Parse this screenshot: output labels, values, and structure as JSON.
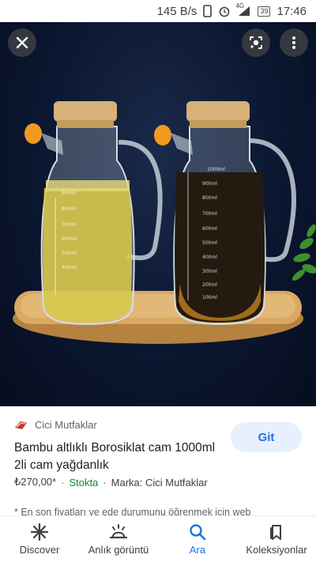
{
  "status_bar": {
    "speed": "145 B/s",
    "network": "4G",
    "battery": "39",
    "time": "17:46"
  },
  "viewer": {
    "close_icon": "close-icon",
    "lens_icon": "google-lens-icon",
    "menu_icon": "more-vert-icon",
    "bottle_markings_left": [
      "900ml",
      "800ml",
      "700ml",
      "600ml",
      "500ml",
      "400ml"
    ],
    "bottle_markings_right": [
      "1000ml",
      "900ml",
      "800ml",
      "700ml",
      "600ml",
      "500ml",
      "400ml",
      "300ml",
      "200ml",
      "100ml"
    ]
  },
  "result": {
    "source": "Cici Mutfaklar",
    "visit_button": "Git",
    "title": "Bambu altlıklı Borosiklat cam 1000ml 2li cam yağdanlık",
    "price": "₺270,00*",
    "stock": "Stokta",
    "brand": "Marka: Cici Mutfaklar",
    "note": "* En son fiyatları ve ede durumunu öğrenmek için web"
  },
  "bottom_nav": {
    "items": [
      {
        "label": "Discover",
        "icon": "discover-icon"
      },
      {
        "label": "Anlık görüntü",
        "icon": "snapshot-icon"
      },
      {
        "label": "Ara",
        "icon": "search-icon"
      },
      {
        "label": "Koleksiyonlar",
        "icon": "collections-icon"
      }
    ],
    "active": "Ara"
  },
  "colors": {
    "accent": "#1a73e8",
    "stock_green": "#188038",
    "viewer_bg": "#0b1630"
  }
}
